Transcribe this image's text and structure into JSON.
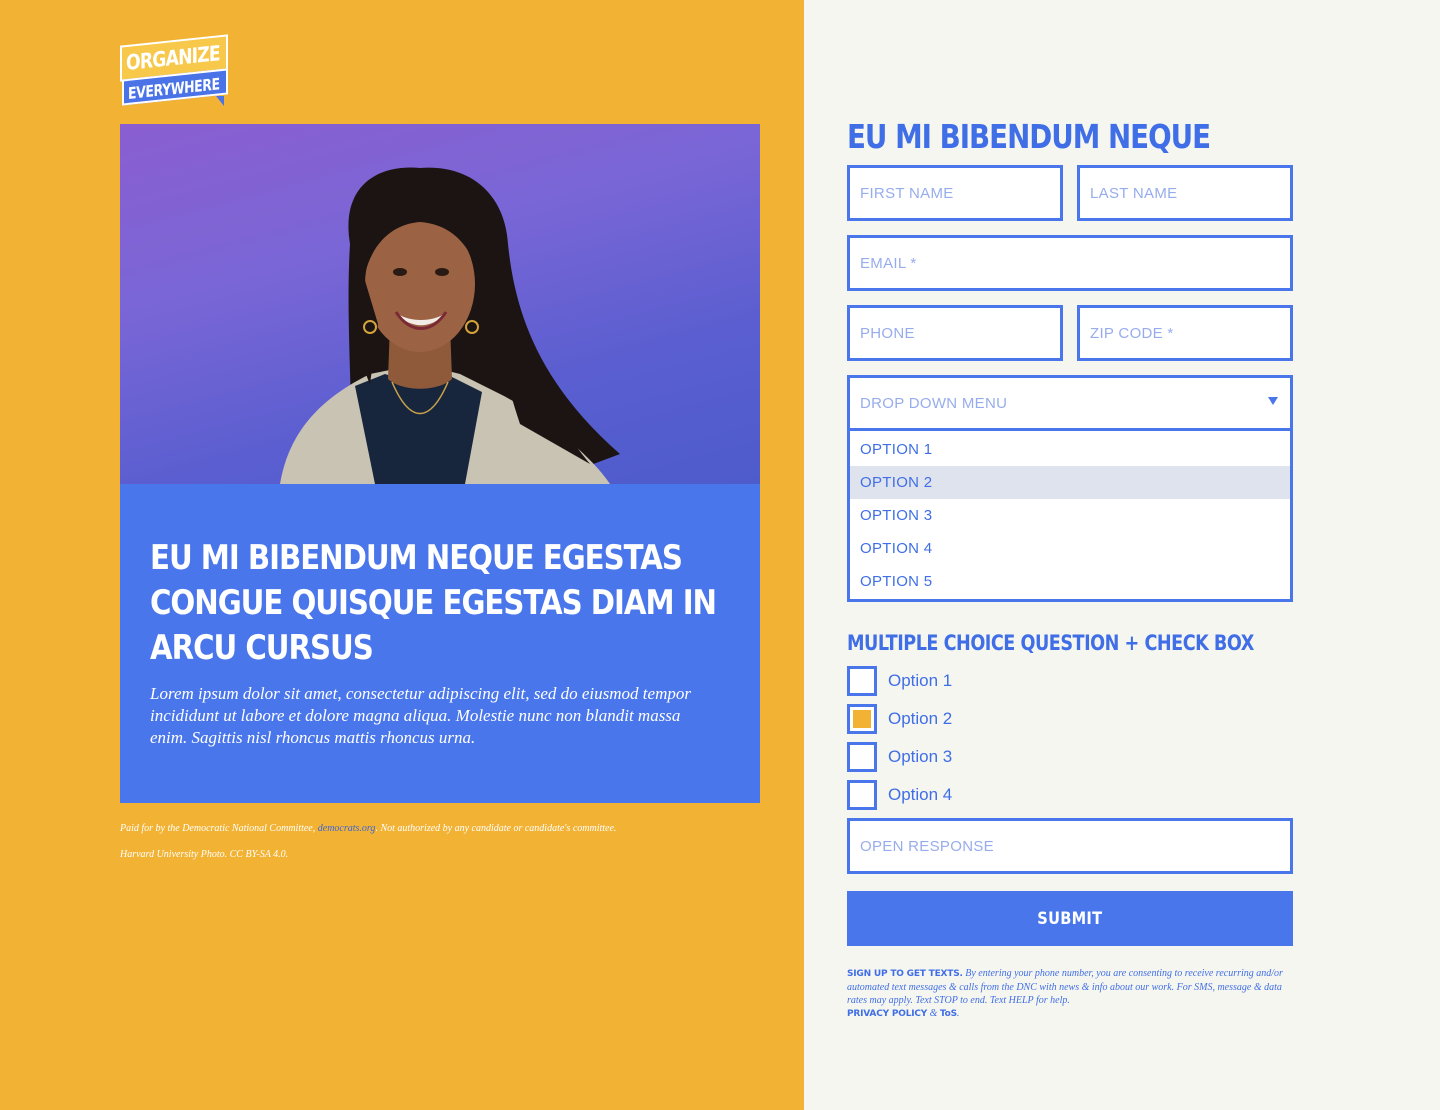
{
  "brand": {
    "logo_top": "ORGANIZE",
    "logo_bottom": "EVERYWHERE"
  },
  "hero": {
    "heading": "EU MI BIBENDUM NEQUE EGESTAS CONGUE QUISQUE EGESTAS DIAM IN ARCU CURSUS",
    "body": "Lorem ipsum dolor sit amet, consectetur adipiscing elit, sed do eiusmod tempor incididunt ut labore et dolore magna aliqua. Molestie nunc non blandit massa enim. Sagittis nisl rhoncus mattis rhoncus urna."
  },
  "disclaimer": {
    "prefix": "Paid for by the Democratic National Committee, ",
    "link": "democrats.org",
    "suffix": ". Not authorized by any candidate or candidate's committee.",
    "photo_credit": "Harvard University Photo. CC BY-SA 4.0."
  },
  "form": {
    "title": "EU MI BIBENDUM NEQUE",
    "first_name_placeholder": "FIRST NAME",
    "last_name_placeholder": "LAST NAME",
    "email_placeholder": "EMAIL *",
    "phone_placeholder": "PHONE",
    "zip_placeholder": "ZIP CODE *",
    "dropdown": {
      "placeholder": "DROP DOWN MENU",
      "options": [
        "OPTION 1",
        "OPTION 2",
        "OPTION 3",
        "OPTION 4",
        "OPTION 5"
      ],
      "highlighted_index": 1
    },
    "multiple_choice": {
      "title": "MULTIPLE CHOICE QUESTION + CHECK BOX",
      "options": [
        {
          "label": "Option 1",
          "checked": false
        },
        {
          "label": "Option 2",
          "checked": true
        },
        {
          "label": "Option 3",
          "checked": false
        },
        {
          "label": "Option 4",
          "checked": false
        }
      ]
    },
    "open_response_placeholder": "OPEN RESPONSE",
    "submit_label": "SUBMIT",
    "legal": {
      "lead": "SIGN UP TO GET TEXTS.",
      "text": " By entering your phone number, you are consenting to receive recurring and/or automated text messages & calls from the DNC with news & info about our work. For SMS, message & data rates may apply. Text STOP to end. Text HELP for help.",
      "privacy": "PRIVACY POLICY",
      "amp": " & ",
      "tos": "ToS",
      "end": "."
    }
  },
  "colors": {
    "yellow": "#f2b335",
    "blue": "#4a76ec",
    "offwhite": "#f6f6f1"
  }
}
